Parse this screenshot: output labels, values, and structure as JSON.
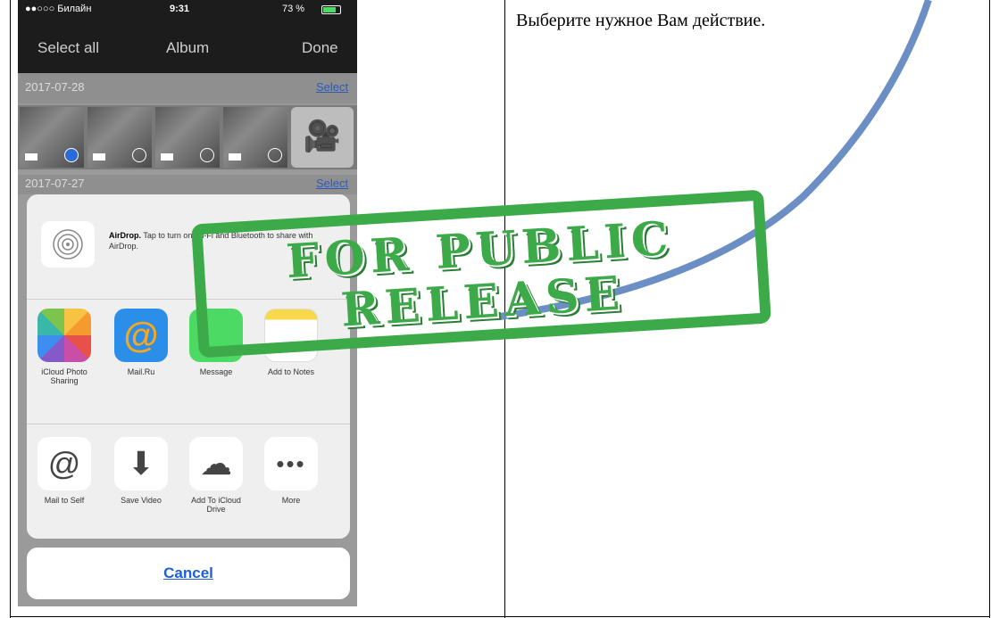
{
  "phone": {
    "status": {
      "carrier": "●●○○○ Билайн",
      "time": "9:31",
      "battery": "73 %"
    },
    "nav": {
      "left": "Select all",
      "title": "Album",
      "right": "Done"
    },
    "sections": [
      {
        "date": "2017-07-28",
        "select": "Select"
      },
      {
        "date": "2017-07-27",
        "select": "Select"
      }
    ],
    "share": {
      "airdrop_title": "AirDrop.",
      "airdrop_text": "Tap to turn on Wi-Fi and Bluetooth to share with AirDrop.",
      "row1": [
        {
          "label": "iCloud Photo Sharing",
          "icon": "photos-icon"
        },
        {
          "label": "Mail.Ru",
          "icon": "mailru-icon"
        },
        {
          "label": "Message",
          "icon": "message-icon"
        },
        {
          "label": "Add to Notes",
          "icon": "notes-icon"
        }
      ],
      "row2": [
        {
          "label": "Mail to Self",
          "icon": "at-icon",
          "glyph": "@"
        },
        {
          "label": "Save Video",
          "icon": "download-icon",
          "glyph": "⬇"
        },
        {
          "label": "Add To iCloud Drive",
          "icon": "cloud-upload-icon",
          "glyph": "☁"
        },
        {
          "label": "More",
          "icon": "more-icon",
          "glyph": "•••"
        }
      ],
      "cancel": "Cancel"
    }
  },
  "document": {
    "right_cell_text": "Выберите нужное Вам действие."
  },
  "stamp": {
    "line1": "FOR PUBLIC",
    "line2": "RELEASE",
    "color": "#3caa48"
  },
  "colors": {
    "arc": "#6b8fc4",
    "link": "#1f5fd6"
  }
}
